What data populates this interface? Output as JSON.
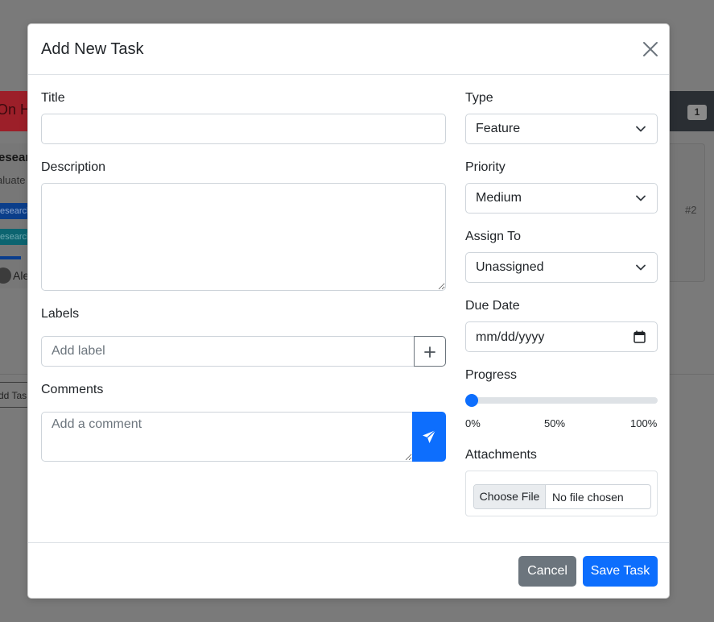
{
  "background": {
    "column_header": "On H",
    "count_badge": "1",
    "card_title": "esearc",
    "card_desc": "aluate",
    "tag_1": "esearch",
    "tag_2": "esearch",
    "assignee": "Ale",
    "card_number": "#2",
    "add_task": "dd Tas"
  },
  "modal": {
    "title": "Add New Task",
    "close_icon": "close-icon"
  },
  "form": {
    "title_label": "Title",
    "title_value": "",
    "description_label": "Description",
    "description_value": "",
    "labels_label": "Labels",
    "label_placeholder": "Add label",
    "comments_label": "Comments",
    "comment_placeholder": "Add a comment",
    "type_label": "Type",
    "type_value": "Feature",
    "priority_label": "Priority",
    "priority_value": "Medium",
    "assign_label": "Assign To",
    "assign_value": "Unassigned",
    "due_date_label": "Due Date",
    "due_date_value": "mm/dd/yyyy",
    "progress_label": "Progress",
    "progress_value": 0,
    "progress_ticks": [
      "0%",
      "50%",
      "100%"
    ],
    "attachments_label": "Attachments",
    "file_button": "Choose File",
    "file_status": "No file chosen"
  },
  "footer": {
    "cancel_label": "Cancel",
    "save_label": "Save Task"
  },
  "colors": {
    "primary": "#0d6efd",
    "secondary": "#6c757d",
    "backdrop": "#7a7a7a"
  }
}
